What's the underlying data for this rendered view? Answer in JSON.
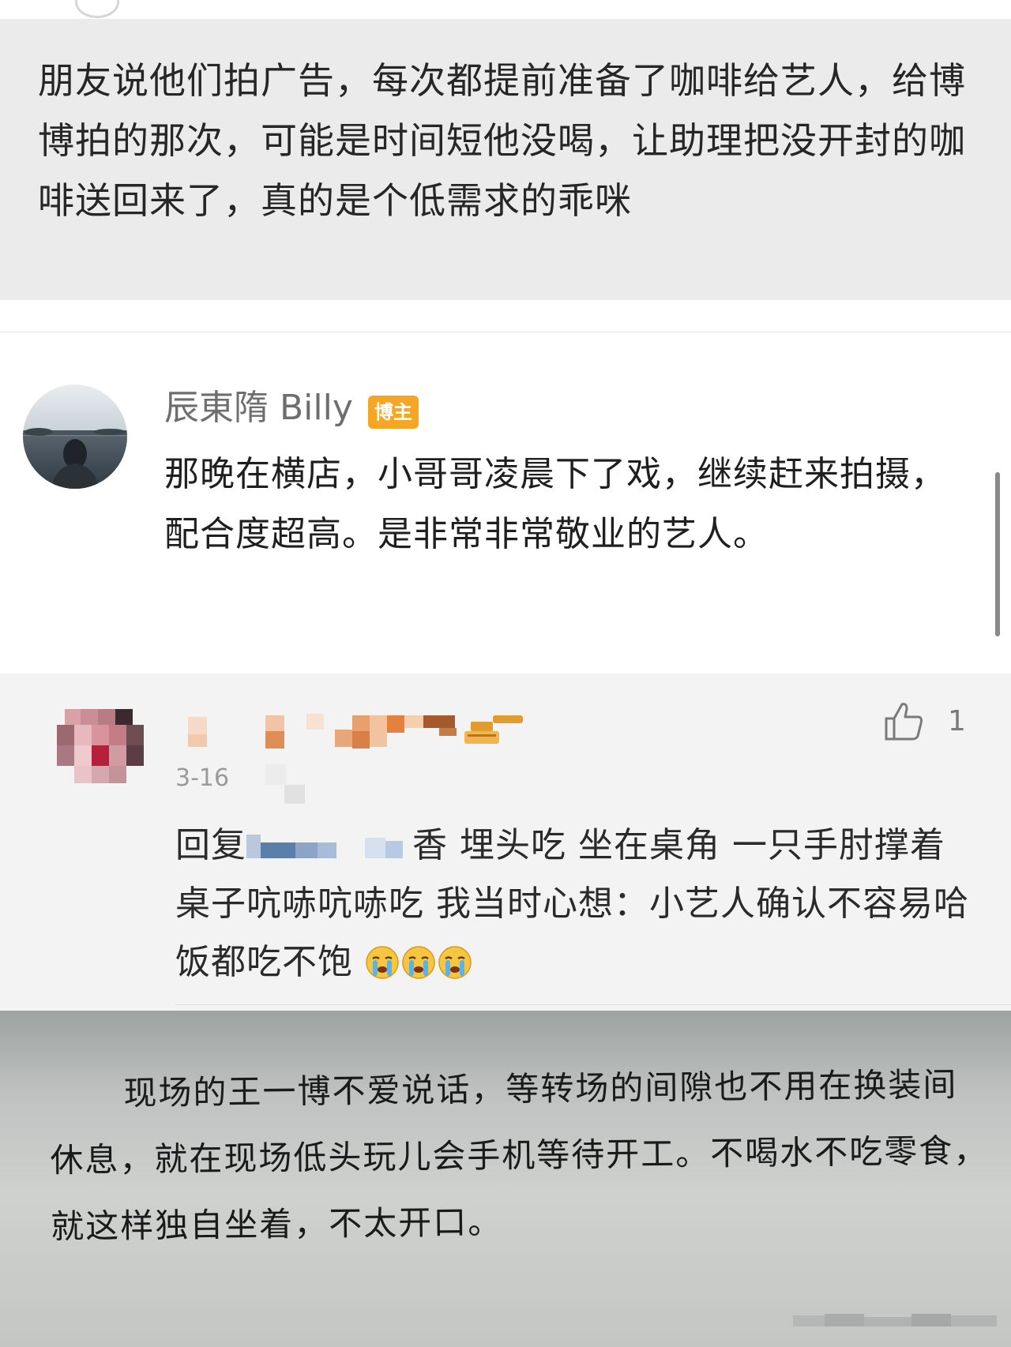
{
  "post": {
    "quote_text": "朋友说他们拍广告，每次都提前准备了咖啡给艺人，给博博拍的那次，可能是时间短他没喝，让助理把没开封的咖啡送回来了，真的是个低需求的乖咪"
  },
  "comment": {
    "username": "辰東隋 Billy",
    "badge": "博主",
    "text": "那晚在横店，小哥哥凌晨下了戏，继续赶来拍摄，配合度超高。是非常非常敬业的艺人。"
  },
  "reply": {
    "date": "3-16",
    "like_count": "1",
    "reply_prefix": "回复",
    "text": "香 埋头吃 坐在桌角 一只手肘撑着桌子吭哧吭哧吃 我当时心想：小艺人确认不容易哈 饭都吃不饱",
    "emojis": [
      "crying-emoji",
      "crying-emoji",
      "crying-emoji"
    ]
  },
  "book": {
    "text": "现场的王一博不爱说话，等转场的间隙也不用在换装间休息，就在现场低头玩儿会手机等待开工。不喝水不吃零食，就这样独自坐着，不太开口。"
  },
  "icons": {
    "like": "thumbs-up-icon",
    "emoji": "crying-face-emoji"
  },
  "colors": {
    "badge_bg": "#f5a623",
    "quote_bg": "#ebebeb",
    "reply_bg": "#f3f3f3",
    "username": "#6e6e6e"
  }
}
